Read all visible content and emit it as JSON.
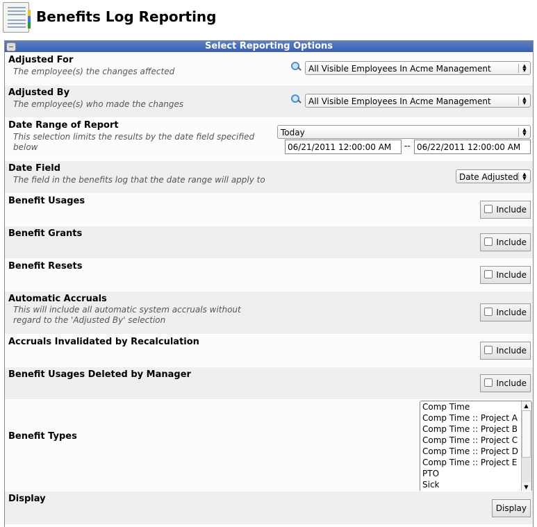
{
  "header": {
    "title": "Benefits Log Reporting",
    "icon": "report-notebook-icon"
  },
  "panel": {
    "title": "Select Reporting Options"
  },
  "adjusted_for": {
    "label": "Adjusted For",
    "desc": "The employee(s) the changes affected",
    "value": "All Visible Employees In Acme Management"
  },
  "adjusted_by": {
    "label": "Adjusted By",
    "desc": "The employee(s) who made the changes",
    "value": "All Visible Employees In Acme Management"
  },
  "date_range": {
    "label": "Date Range of Report",
    "desc": "This selection limits the results by the date field specified below",
    "value": "Today",
    "start": "06/21/2011 12:00:00 AM",
    "sep": "--",
    "end": "06/22/2011 12:00:00 AM"
  },
  "date_field": {
    "label": "Date Field",
    "desc": "The field in the benefits log that the date range will apply to",
    "value": "Date Adjusted"
  },
  "include_rows": [
    {
      "label": "Benefit Usages",
      "desc": "",
      "button": "Include",
      "checked": false
    },
    {
      "label": "Benefit Grants",
      "desc": "",
      "button": "Include",
      "checked": false
    },
    {
      "label": "Benefit Resets",
      "desc": "",
      "button": "Include",
      "checked": false
    },
    {
      "label": "Automatic Accruals",
      "desc": "This will include all automatic system accruals without regard to the 'Adjusted By' selection",
      "button": "Include",
      "checked": false
    },
    {
      "label": "Accruals Invalidated by Recalculation",
      "desc": "",
      "button": "Include",
      "checked": false
    },
    {
      "label": "Benefit Usages Deleted by Manager",
      "desc": "",
      "button": "Include",
      "checked": false
    }
  ],
  "benefit_types": {
    "label": "Benefit Types",
    "options": [
      "Comp Time",
      "Comp Time :: Project A",
      "Comp Time :: Project B",
      "Comp Time :: Project C",
      "Comp Time :: Project D",
      "Comp Time :: Project E",
      "PTO",
      "Sick"
    ]
  },
  "display": {
    "label": "Display",
    "button": "Display"
  }
}
